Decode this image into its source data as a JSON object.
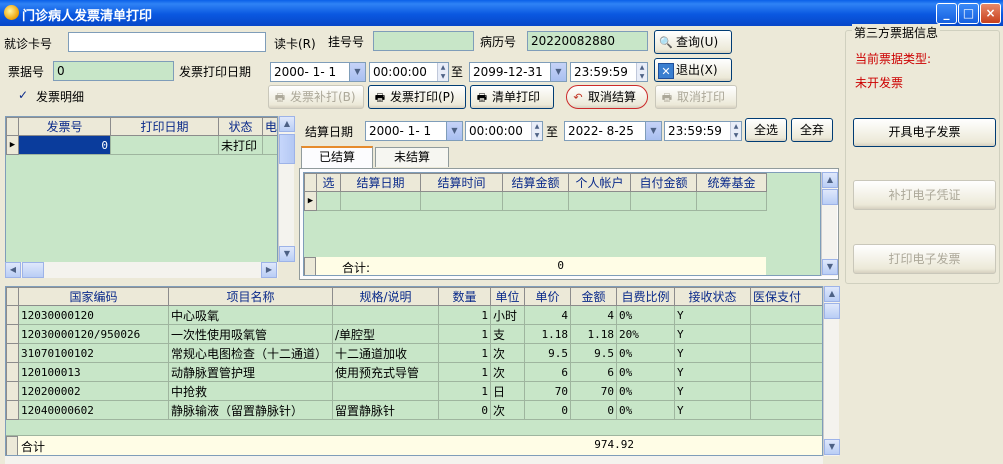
{
  "window": {
    "title": "门诊病人发票清单打印",
    "minimize": "_",
    "maximize": "□",
    "close": "×"
  },
  "top": {
    "card_label": "就诊卡号",
    "card_value": "",
    "read_card": "读卡(R)",
    "reg_label": "挂号号",
    "reg_value": "",
    "record_label": "病历号",
    "record_value": "20220082880",
    "query": "查询(U)",
    "bill_label": "票据号",
    "bill_value": "0",
    "print_date_label": "发票打印日期",
    "date_from": "2000- 1- 1",
    "time_from": "00:00:00",
    "to": "至",
    "date_to": "2099-12-31",
    "time_to": "23:59:59",
    "exit": "退出(X)",
    "detail_check": "发票明细",
    "detail_checked": "✓",
    "btn_reprint": "发票补打(B)",
    "btn_print": "发票打印(P)",
    "btn_list_print": "清单打印",
    "btn_cancel_settle": "取消结算",
    "btn_cancel_print": "取消打印"
  },
  "invoice_grid": {
    "headers": [
      "发票号",
      "打印日期",
      "状态",
      "电"
    ],
    "rows": [
      [
        "0",
        "",
        "未打印",
        ""
      ]
    ]
  },
  "settle": {
    "date_label": "结算日期",
    "date_from": "2000- 1- 1",
    "time_from": "00:00:00",
    "to": "至",
    "date_to": "2022- 8-25",
    "time_to": "23:59:59",
    "select_all": "全选",
    "deselect": "全弃",
    "tab_settled": "已结算",
    "tab_unsettled": "未结算",
    "headers": [
      "选",
      "结算日期",
      "结算时间",
      "结算金额",
      "个人帐户",
      "自付金额",
      "统筹基金"
    ],
    "total_label": "合计:",
    "total_amount": "0"
  },
  "third_party": {
    "title": "第三方票据信息",
    "type_label": "当前票据类型:",
    "type_value": "未开发票",
    "btn_issue": "开具电子发票",
    "btn_reprint": "补打电子凭证",
    "btn_print": "打印电子发票"
  },
  "items": {
    "headers": [
      "国家编码",
      "项目名称",
      "规格/说明",
      "数量",
      "单位",
      "单价",
      "金额",
      "自费比例",
      "接收状态",
      "医保支付"
    ],
    "rows": [
      [
        "12030000120",
        "中心吸氧",
        "",
        "1",
        "小时",
        "4",
        "4",
        "0%",
        "Y",
        ""
      ],
      [
        "12030000120/950026",
        "一次性使用吸氧管",
        "/单腔型",
        "1",
        "支",
        "1.18",
        "1.18",
        "20%",
        "Y",
        ""
      ],
      [
        "31070100102",
        "常规心电图检查（十二通道）",
        "十二通道加收",
        "1",
        "次",
        "9.5",
        "9.5",
        "0%",
        "Y",
        ""
      ],
      [
        "120100013",
        "动静脉置管护理",
        "使用预充式导管",
        "1",
        "次",
        "6",
        "6",
        "0%",
        "Y",
        ""
      ],
      [
        "120200002",
        "中抢救",
        "",
        "1",
        "日",
        "70",
        "70",
        "0%",
        "Y",
        ""
      ],
      [
        "12040000602",
        "静脉输液（留置静脉针）",
        "留置静脉针",
        "0",
        "次",
        "0",
        "0",
        "0%",
        "Y",
        ""
      ]
    ],
    "total_label": "合计",
    "total_amount": "974.92"
  },
  "colors": {
    "accent_red": "#cc0000",
    "grid_green": "#c8e6c8",
    "header_blue": "#0a2a8a"
  }
}
